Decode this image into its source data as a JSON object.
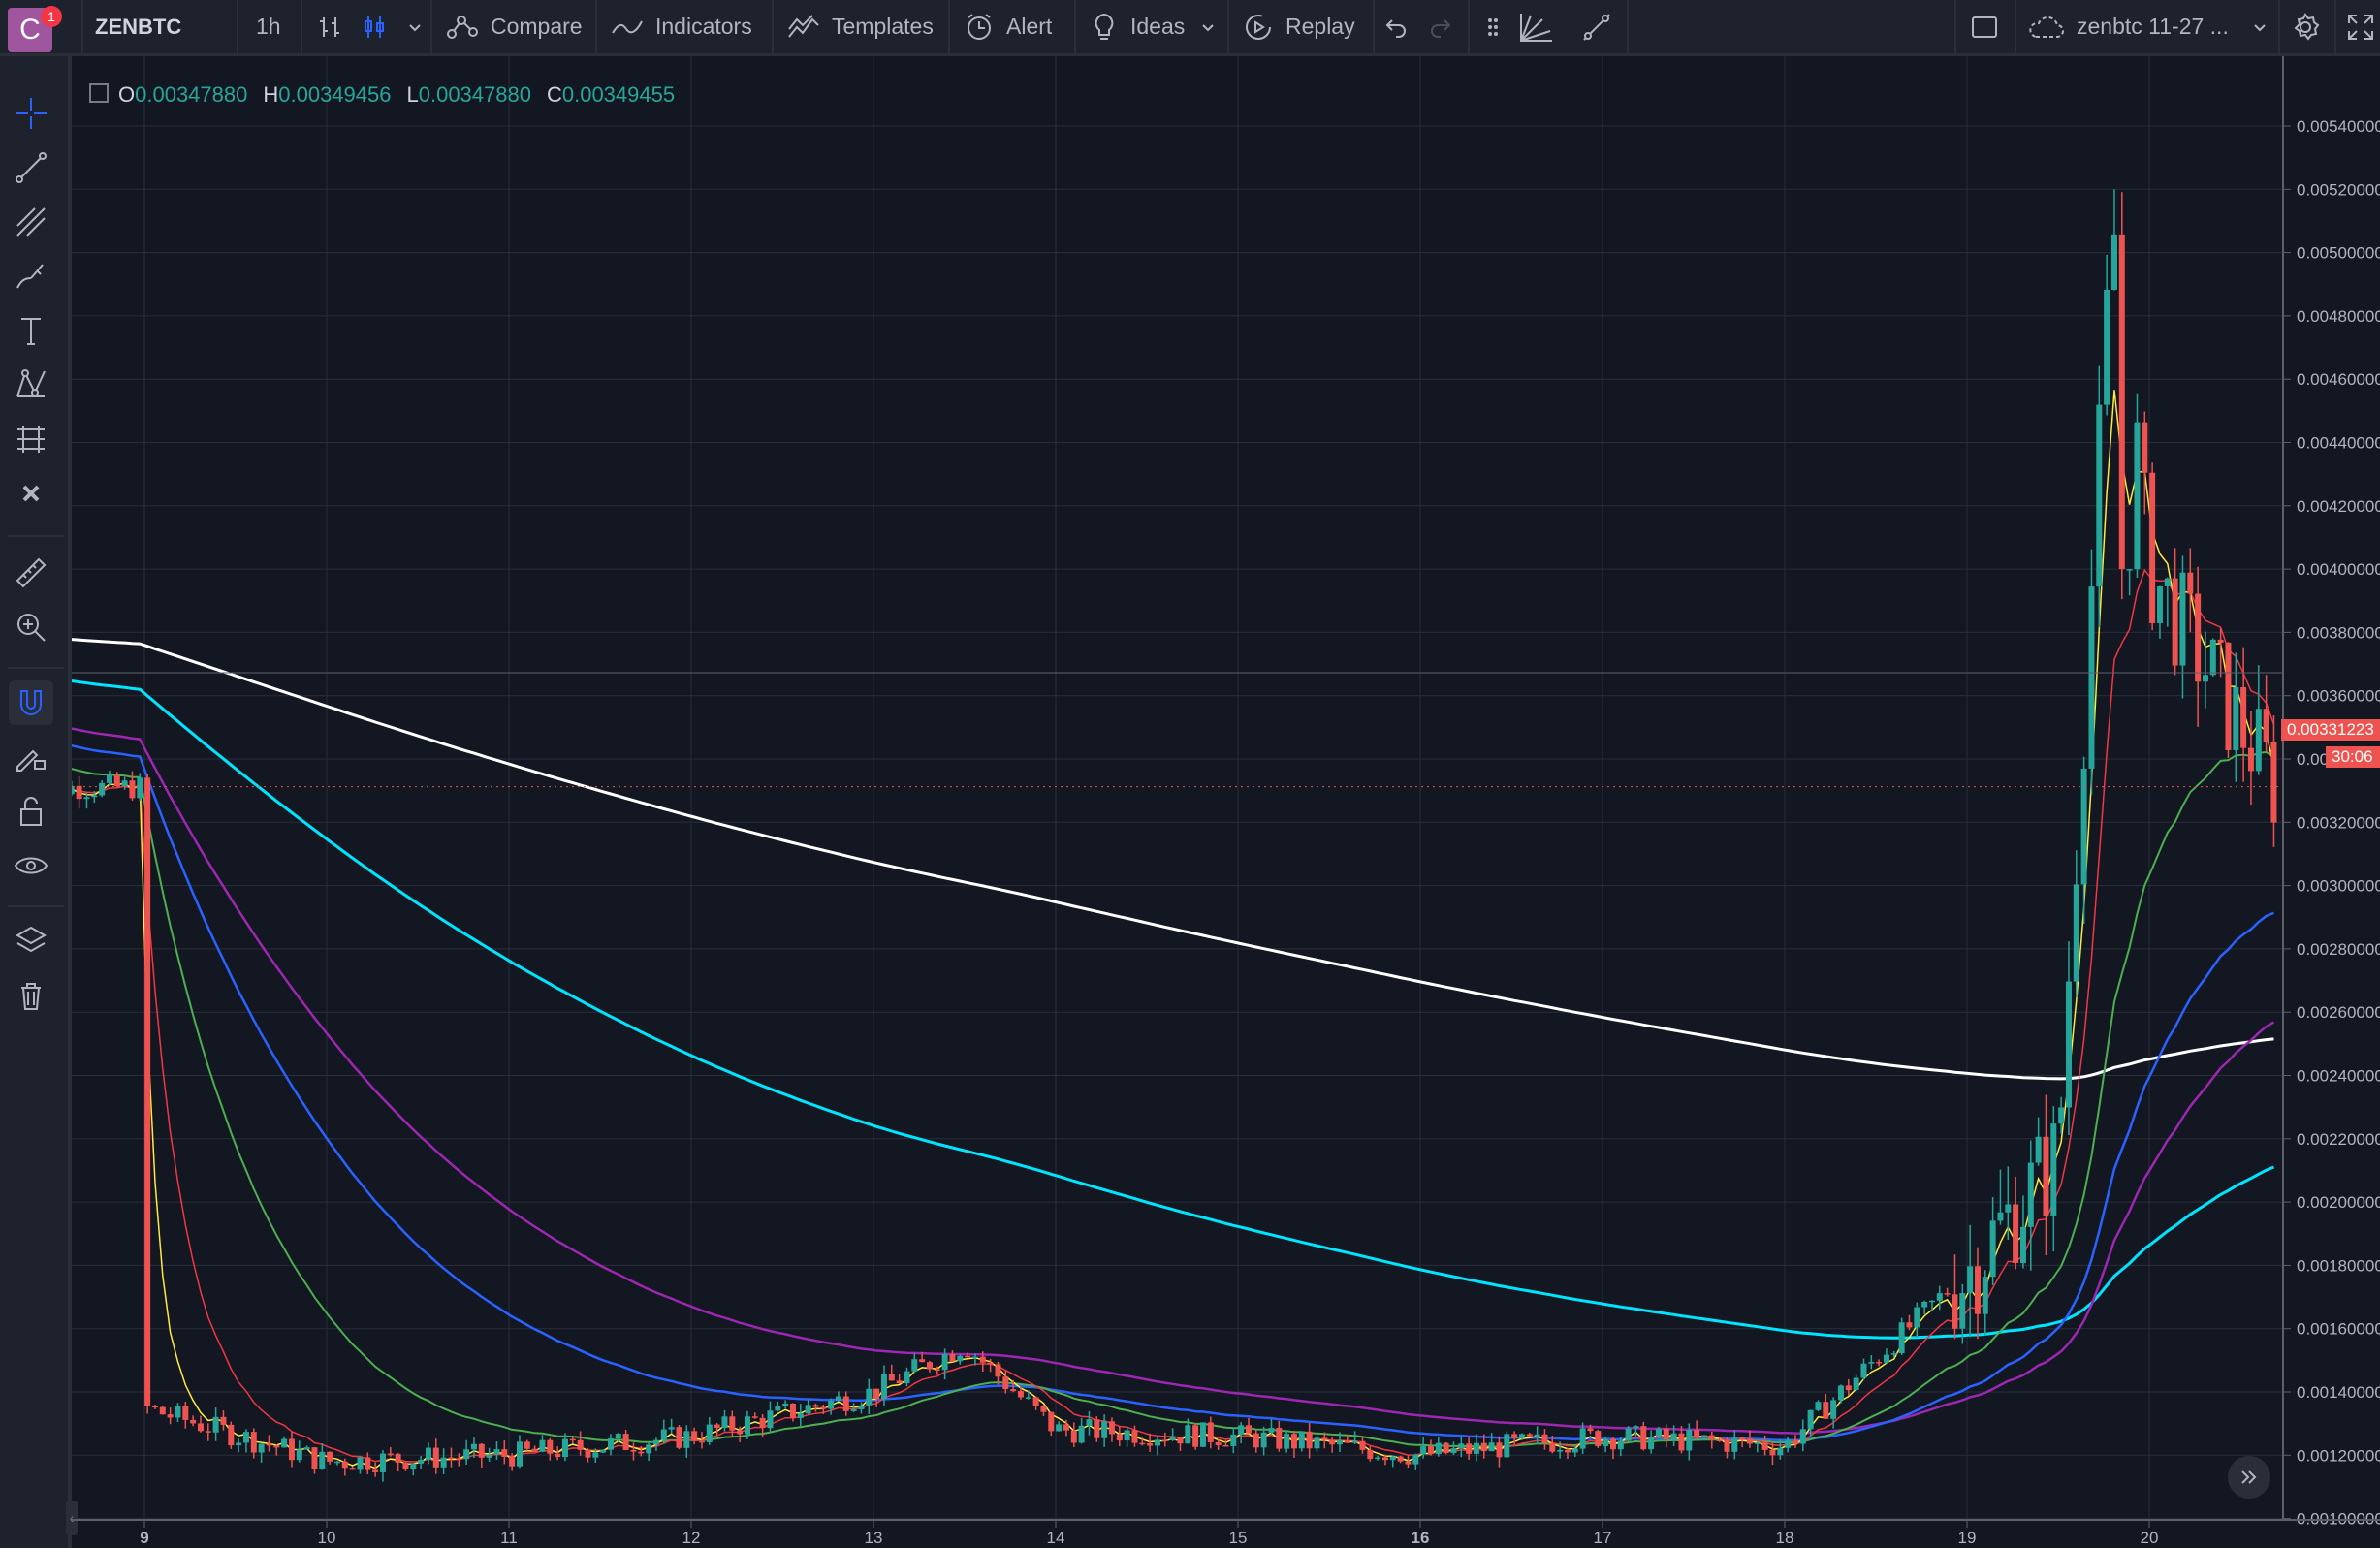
{
  "toolbar": {
    "logo_letter": "C",
    "notification_count": "1",
    "symbol": "ZENBTC",
    "interval": "1h",
    "compare": "Compare",
    "indicators": "Indicators",
    "templates": "Templates",
    "alert": "Alert",
    "ideas": "Ideas",
    "replay": "Replay",
    "layout_name": "zenbtc 11-27 ..."
  },
  "left_tools": [
    "crosshair-icon",
    "trend-line-icon",
    "pitchfork-icon",
    "brush-icon",
    "text-icon",
    "pattern-icon",
    "prediction-icon",
    "remove-icon",
    "ruler-icon",
    "zoom-icon",
    "magnet-icon",
    "lock-drawing-icon",
    "lock-icon",
    "eye-icon",
    "layers-icon",
    "trash-icon"
  ],
  "ohlc": {
    "o_label": "O",
    "o": "0.00347880",
    "h_label": "H",
    "h": "0.00349456",
    "l_label": "L",
    "l": "0.00347880",
    "c_label": "C",
    "c": "0.00349455"
  },
  "price_scale": {
    "ticks": [
      "0.00540000",
      "0.00520000",
      "0.00500000",
      "0.00480000",
      "0.00460000",
      "0.00440000",
      "0.00420000",
      "0.00400000",
      "0.00380000",
      "0.00360000",
      "0.00340000",
      "0.00320000",
      "0.00300000",
      "0.00280000",
      "0.00260000",
      "0.00240000",
      "0.00220000",
      "0.00200000",
      "0.00180000",
      "0.00160000",
      "0.00140000",
      "0.00120000",
      "0.00100000"
    ],
    "last_price": "0.00331223",
    "countdown": "30:06"
  },
  "time_scale": [
    "9",
    "10",
    "11",
    "12",
    "13",
    "14",
    "15",
    "16",
    "17",
    "18",
    "19",
    "20"
  ],
  "colors": {
    "up": "#26a69a",
    "down": "#ef5350",
    "ma_yellow": "#ffeb3b",
    "ma_red": "#f23645",
    "ma_green": "#4caf50",
    "ma_blue": "#2962ff",
    "ma_purple": "#9c27b0",
    "ma_cyan": "#00e5ff",
    "ma_white": "#ffffff"
  },
  "chart_data": {
    "type": "candlestick",
    "symbol": "ZENBTC",
    "interval": "1h",
    "ylim": [
      0.00095,
      0.00545
    ],
    "x_labels": [
      "9",
      "10",
      "11",
      "12",
      "13",
      "14",
      "15",
      "16",
      "17",
      "18",
      "19",
      "20"
    ],
    "key_points": [
      {
        "x": "9",
        "close": 0.00135
      },
      {
        "x": "10",
        "close": 0.00118
      },
      {
        "x": "11",
        "close": 0.0012
      },
      {
        "x": "12",
        "close": 0.00126
      },
      {
        "x": "13",
        "close": 0.0014
      },
      {
        "x": "13.5",
        "close": 0.00155
      },
      {
        "x": "14",
        "close": 0.00128
      },
      {
        "x": "15",
        "close": 0.00126
      },
      {
        "x": "16",
        "close": 0.0012
      },
      {
        "x": "17",
        "close": 0.00126
      },
      {
        "x": "18",
        "close": 0.00123
      },
      {
        "x": "19",
        "close": 0.00178
      },
      {
        "x": "19.5",
        "close": 0.00215
      },
      {
        "x": "19.8",
        "close": 0.0051
      },
      {
        "x": "20",
        "close": 0.004
      },
      {
        "x": "20.3",
        "close": 0.0037
      },
      {
        "x": "20.7",
        "close": 0.00331
      }
    ],
    "series": [
      {
        "name": "MA yellow",
        "color": "#ffeb3b"
      },
      {
        "name": "MA red",
        "color": "#f23645"
      },
      {
        "name": "MA green",
        "color": "#4caf50"
      },
      {
        "name": "MA blue",
        "color": "#2962ff"
      },
      {
        "name": "MA purple",
        "color": "#9c27b0"
      },
      {
        "name": "MA cyan",
        "color": "#00e5ff"
      },
      {
        "name": "MA white",
        "color": "#ffffff"
      }
    ]
  }
}
